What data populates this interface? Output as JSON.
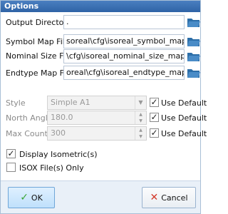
{
  "window": {
    "title": "Options"
  },
  "fields": {
    "output_directory": {
      "label": "Output Directory",
      "value": "."
    },
    "symbol_map_file": {
      "label": "Symbol Map File",
      "value": "soreal\\cfg\\isoreal_symbol_map.ptd"
    },
    "nominal_size_file": {
      "label": "Nominal Size File",
      "value": "\\cfg\\isoreal_nominal_size_map.ptd"
    },
    "endtype_map_file": {
      "label": "Endtype Map File",
      "value": "oreal\\cfg\\isoreal_endtype_map.ptd"
    }
  },
  "style": {
    "label": "Style",
    "value": "Simple A1",
    "use_default_label": "Use Default",
    "use_default_checked": true
  },
  "north_angle": {
    "label": "North Angle",
    "value": "180.0",
    "use_default_label": "Use Default",
    "use_default_checked": true
  },
  "max_count": {
    "label": "Max Count",
    "value": "300",
    "use_default_label": "Use Default",
    "use_default_checked": true
  },
  "options": {
    "display_isometrics": {
      "label": "Display Isometric(s)",
      "checked": true
    },
    "isox_only": {
      "label": "ISOX File(s) Only",
      "checked": false
    }
  },
  "buttons": {
    "ok": "OK",
    "cancel": "Cancel"
  },
  "colors": {
    "accent": "#2f63a6",
    "ok_check": "#3aa635",
    "cancel_x": "#d43a2a",
    "folder": "#2c6ea8"
  }
}
